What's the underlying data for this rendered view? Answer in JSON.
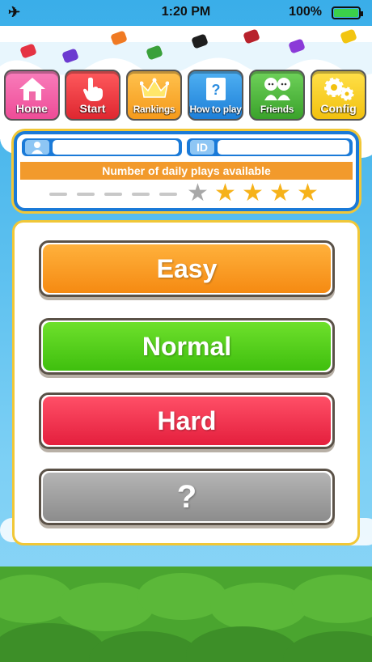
{
  "status_bar": {
    "time": "1:20 PM",
    "battery": "100%"
  },
  "menu": [
    {
      "label": "Home",
      "icon": "house-icon",
      "color": "#f15ca0"
    },
    {
      "label": "Start",
      "icon": "hand-pointer-icon",
      "color": "#ee3a3f"
    },
    {
      "label": "Rankings",
      "icon": "crown-icon",
      "color": "#f5a528"
    },
    {
      "label": "How to play",
      "icon": "question-book-icon",
      "color": "#2d8ee0"
    },
    {
      "label": "Friends",
      "icon": "friends-icon",
      "color": "#49b63a"
    },
    {
      "label": "Config",
      "icon": "gears-icon",
      "color": "#f2cc12"
    }
  ],
  "profile": {
    "name": "",
    "id_label": "ID",
    "id_value": ""
  },
  "daily_plays": {
    "label": "Number of daily plays available",
    "available": 4,
    "max": 10
  },
  "difficulty": [
    {
      "label": "Easy",
      "color": "#f99b1f"
    },
    {
      "label": "Normal",
      "color": "#52d41a"
    },
    {
      "label": "Hard",
      "color": "#ef3552"
    },
    {
      "label": "?",
      "color": "#9c9c9c"
    }
  ]
}
